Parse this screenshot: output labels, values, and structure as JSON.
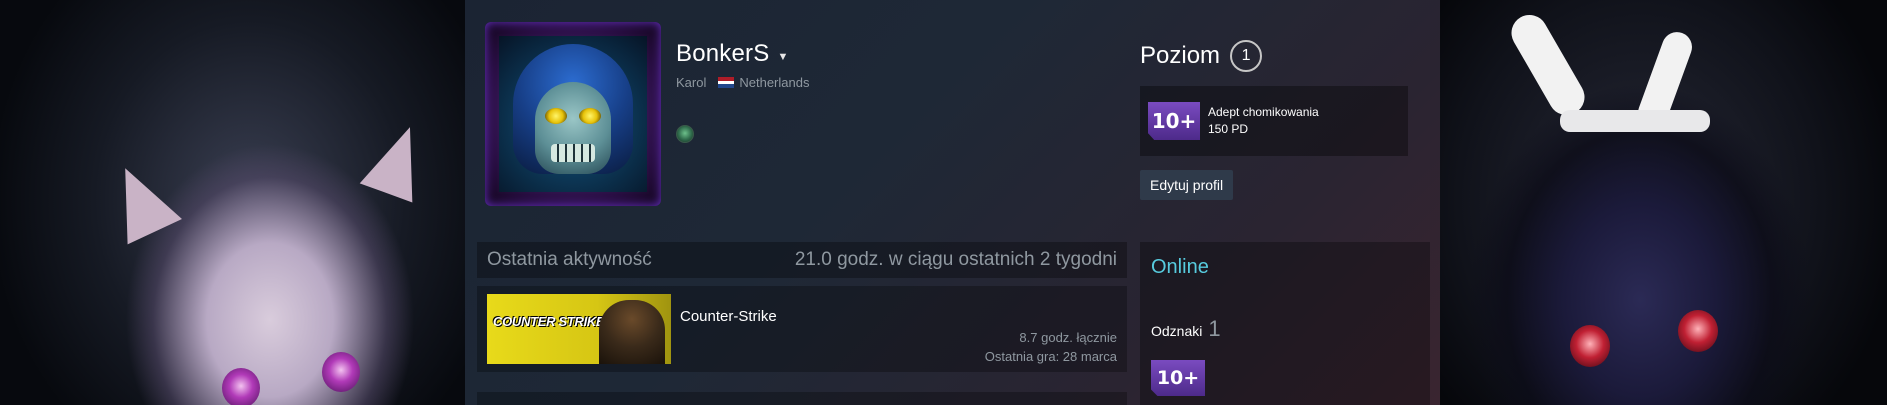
{
  "profile": {
    "persona_name": "BonkerS",
    "real_name": "Karol",
    "country": "Netherlands",
    "country_flag_colors": [
      "#ae1c28",
      "#ffffff",
      "#21468b"
    ]
  },
  "level": {
    "label": "Poziom",
    "value": "1"
  },
  "featured_badge": {
    "icon_text": "10+",
    "name": "Adept chomikowania",
    "xp": "150 PD"
  },
  "edit_button": {
    "label": "Edytuj profil"
  },
  "activity": {
    "title": "Ostatnia aktywność",
    "summary": "21.0 godz. w ciągu ostatnich 2 tygodni",
    "games": [
      {
        "name": "Counter-Strike",
        "capsule_text": "COUNTER STRIKE",
        "total_hours": "8.7 godz. łącznie",
        "last_played": "Ostatnia gra: 28 marca"
      }
    ]
  },
  "side_panel": {
    "status": "Online",
    "badges_label": "Odznaki",
    "badges_count": "1",
    "badge_icon_text": "10+"
  },
  "colors": {
    "online": "#57cbde",
    "badge_purple": "#7a4bc0"
  }
}
